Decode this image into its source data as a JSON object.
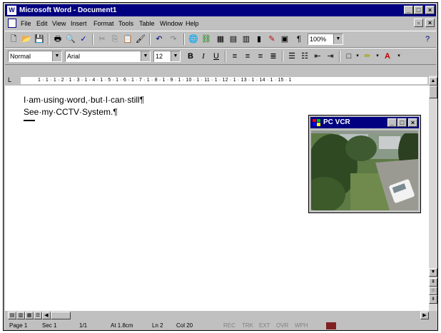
{
  "window": {
    "title": "Microsoft Word - Document1",
    "controls": {
      "minimize": "_",
      "maximize": "□",
      "close": "×"
    }
  },
  "menu": {
    "items": [
      "File",
      "Edit",
      "View",
      "Insert",
      "Format",
      "Tools",
      "Table",
      "Window",
      "Help"
    ]
  },
  "standard_toolbar": {
    "zoom": "100%"
  },
  "formatting_toolbar": {
    "style": "Normal",
    "font": "Arial",
    "size": "12",
    "bold": "B",
    "italic": "I",
    "underline": "U"
  },
  "ruler": {
    "ticks": "1 · 1 · 1 · 2 · 1 · 3 · 1 · 4 · 1 · 5 · 1 · 6 · 1 · 7 · 1 · 8 · 1 · 9 · 1 · 10 · 1 · 11 · 1 · 12 · 1 · 13 · 1 · 14 · 1 · 15 · 1"
  },
  "document": {
    "lines": [
      "I·am·using·word,·but·I·can·still¶",
      "See·my·CCTV·System.¶"
    ]
  },
  "pcvcr": {
    "title": "PC VCR"
  },
  "status": {
    "page": "Page 1",
    "sec": "Sec 1",
    "pages": "1/1",
    "at": "At 1.8cm",
    "ln": "Ln 2",
    "col": "Col 20",
    "rec": "REC",
    "trk": "TRK",
    "ext": "EXT",
    "ovr": "OVR",
    "wph": "WPH"
  }
}
